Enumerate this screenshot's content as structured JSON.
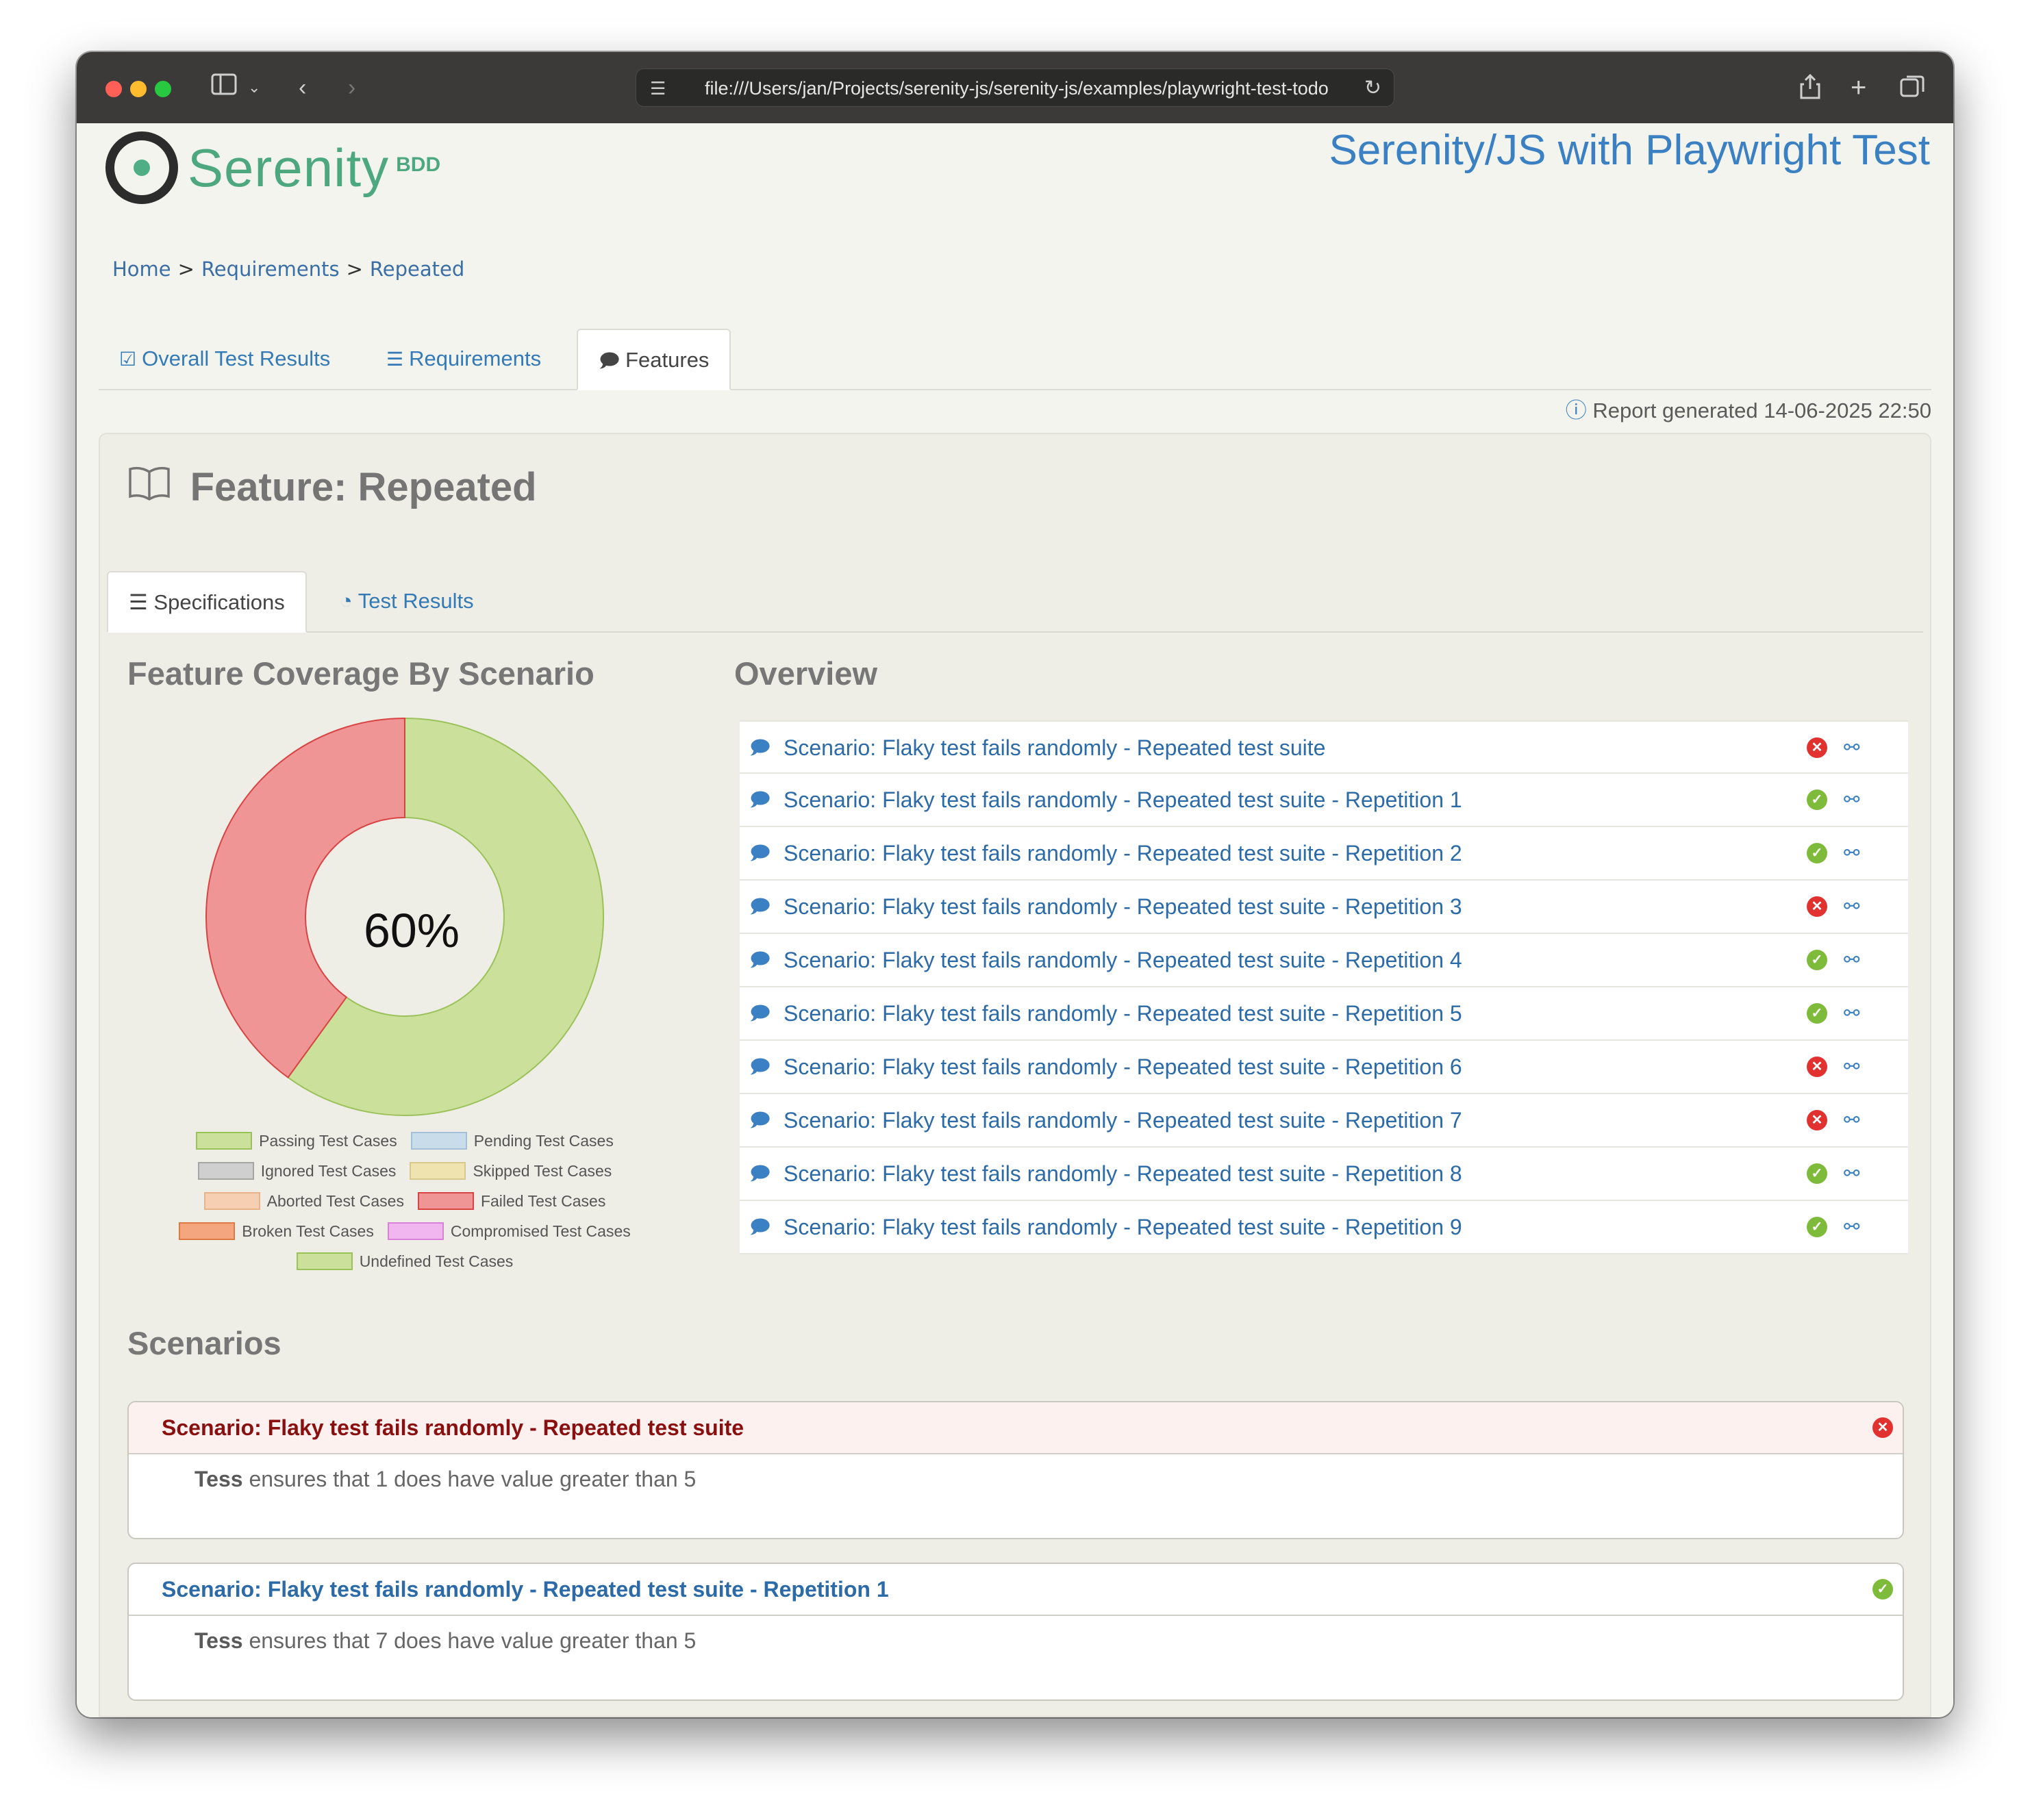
{
  "browser": {
    "url": "file:///Users/jan/Projects/serenity-js/serenity-js/examples/playwright-test-todo"
  },
  "header": {
    "logo_text": "Serenity",
    "logo_suffix": "BDD",
    "project_title": "Serenity/JS with Playwright Test"
  },
  "breadcrumb": {
    "home": "Home",
    "requirements": "Requirements",
    "current": "Repeated",
    "separator": ">"
  },
  "main_tabs": [
    {
      "label": "Overall Test Results",
      "active": false
    },
    {
      "label": "Requirements",
      "active": false
    },
    {
      "label": "Features",
      "active": true
    }
  ],
  "report_generated": "Report generated 14-06-2025 22:50",
  "feature": {
    "title": "Feature: Repeated",
    "sub_tabs": [
      {
        "label": "Specifications",
        "active": true
      },
      {
        "label": "Test Results",
        "active": false
      }
    ]
  },
  "coverage": {
    "heading": "Feature Coverage By Scenario",
    "percent_label": "60%",
    "legend": [
      {
        "label": "Passing Test Cases",
        "fill": "#cbe09b",
        "stroke": "#9bc25a"
      },
      {
        "label": "Pending Test Cases",
        "fill": "#c9dcea",
        "stroke": "#a4c0d8"
      },
      {
        "label": "Ignored Test Cases",
        "fill": "#cfcfcf",
        "stroke": "#a5a5a5"
      },
      {
        "label": "Skipped Test Cases",
        "fill": "#efe4b0",
        "stroke": "#d8c98a"
      },
      {
        "label": "Aborted Test Cases",
        "fill": "#f6cfb2",
        "stroke": "#e9b28b"
      },
      {
        "label": "Failed Test Cases",
        "fill": "#ef9595",
        "stroke": "#d94343"
      },
      {
        "label": "Broken Test Cases",
        "fill": "#f4a77e",
        "stroke": "#e07a45"
      },
      {
        "label": "Compromised Test Cases",
        "fill": "#f1b6ef",
        "stroke": "#d981d6"
      },
      {
        "label": "Undefined Test Cases",
        "fill": "#cbe09b",
        "stroke": "#9bc25a"
      }
    ]
  },
  "chart_data": {
    "type": "pie",
    "categories": [
      "Passing Test Cases",
      "Failed Test Cases"
    ],
    "values": [
      6,
      4
    ],
    "colors": [
      "#cbe09b",
      "#ef9595"
    ]
  },
  "overview": {
    "heading": "Overview",
    "rows": [
      {
        "label": "Scenario: Flaky test fails randomly - Repeated test suite",
        "status": "failed"
      },
      {
        "label": "Scenario: Flaky test fails randomly - Repeated test suite - Repetition 1",
        "status": "passed"
      },
      {
        "label": "Scenario: Flaky test fails randomly - Repeated test suite - Repetition 2",
        "status": "passed"
      },
      {
        "label": "Scenario: Flaky test fails randomly - Repeated test suite - Repetition 3",
        "status": "failed"
      },
      {
        "label": "Scenario: Flaky test fails randomly - Repeated test suite - Repetition 4",
        "status": "passed"
      },
      {
        "label": "Scenario: Flaky test fails randomly - Repeated test suite - Repetition 5",
        "status": "passed"
      },
      {
        "label": "Scenario: Flaky test fails randomly - Repeated test suite - Repetition 6",
        "status": "failed"
      },
      {
        "label": "Scenario: Flaky test fails randomly - Repeated test suite - Repetition 7",
        "status": "failed"
      },
      {
        "label": "Scenario: Flaky test fails randomly - Repeated test suite - Repetition 8",
        "status": "passed"
      },
      {
        "label": "Scenario: Flaky test fails randomly - Repeated test suite - Repetition 9",
        "status": "passed"
      }
    ]
  },
  "scenarios": {
    "heading": "Scenarios",
    "cards": [
      {
        "title": "Scenario: Flaky test fails randomly - Repeated test suite",
        "status": "failed",
        "actor": "Tess",
        "step": "ensures that 1 does have value greater than 5"
      },
      {
        "title": "Scenario: Flaky test fails randomly - Repeated test suite - Repetition 1",
        "status": "passed",
        "actor": "Tess",
        "step": "ensures that 7 does have value greater than 5"
      }
    ]
  }
}
